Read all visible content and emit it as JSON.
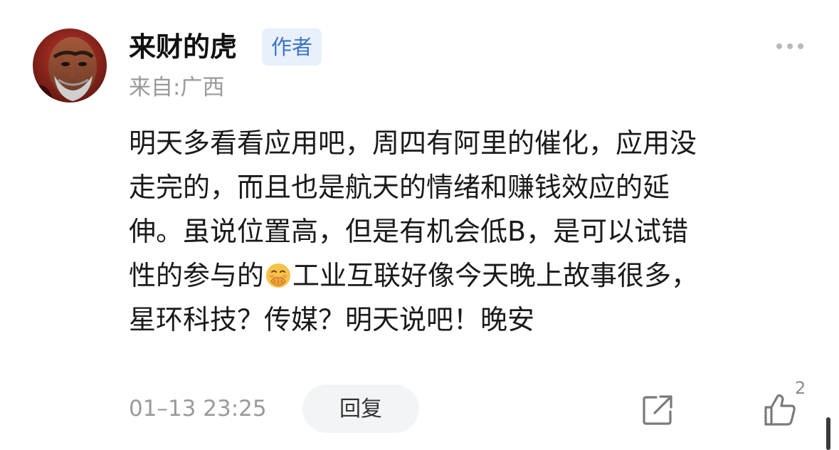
{
  "comment": {
    "user": {
      "name": "来财的虎",
      "badge": "作者",
      "location": "来自:广西"
    },
    "body_lines": [
      "明天多看看应用吧，周四有阿里的催化，应用没",
      "走完的，而且也是航天的情绪和赚钱效应的延",
      "伸。虽说位置高，但是有机会低B，是可以试错",
      "性的参与的",
      "工业互联好像今天晚上故事很多，",
      "星环科技？传媒？明天说吧！晚安"
    ],
    "inline_emoji": "smiling-face-with-hand-over-mouth-icon",
    "footer": {
      "timestamp": "01–13 23:25",
      "reply_label": "回复",
      "like_count": "2"
    }
  },
  "icons": {
    "more": "more-dots-icon",
    "share": "share-external-icon",
    "like": "thumbs-up-icon"
  },
  "colors": {
    "badge_background": "#e8f0fb",
    "badge_text": "#3b73c5",
    "secondary_text": "#9a9a9a",
    "reply_button_background": "#f3f4f6"
  }
}
